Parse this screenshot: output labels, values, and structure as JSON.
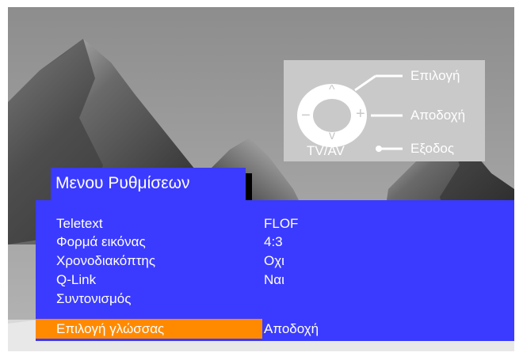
{
  "remote_hint": {
    "select_label": "Επιλογή",
    "accept_label": "Αποδοχή",
    "exit_label": "Εξοδος",
    "tvav_label": "TV/AV",
    "up_glyph": "^",
    "down_glyph": "v",
    "minus_glyph": "−",
    "plus_glyph": "+"
  },
  "menu": {
    "title": "Μενου Ρυθμίσεων",
    "items": [
      {
        "label": "Teletext",
        "value": "FLOF"
      },
      {
        "label": "Φορμά εικόνας",
        "value": "4:3"
      },
      {
        "label": "Χρονοδιακόπτης",
        "value": "Οχι"
      },
      {
        "label": "Q-Link",
        "value": "Ναι"
      },
      {
        "label": "Συντονισμός",
        "value": ""
      },
      {
        "label": "Επιλογή γλώσσας",
        "value": "Αποδοχή",
        "selected": true
      }
    ]
  },
  "colors": {
    "panel_blue": "#3b3bff",
    "highlight_orange": "#ff8a00",
    "hint_gray": "#c9c9c9"
  }
}
